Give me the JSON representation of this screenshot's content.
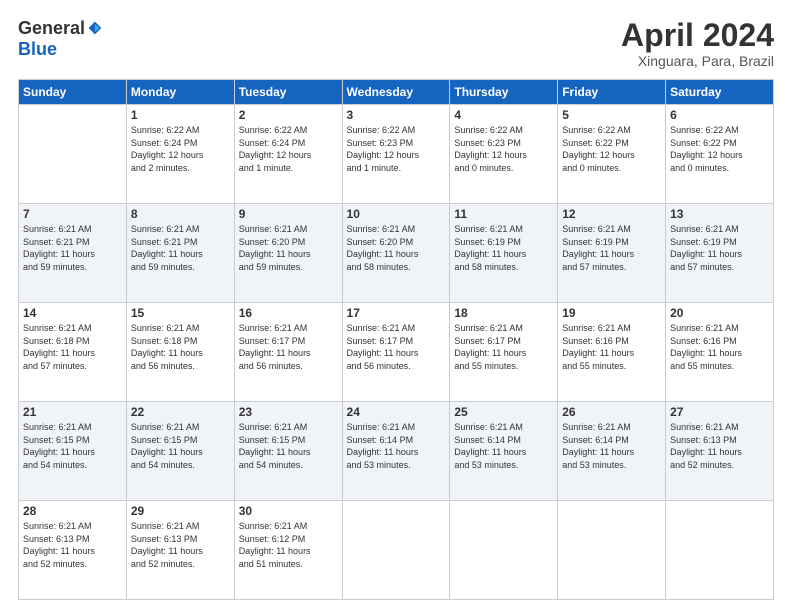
{
  "header": {
    "logo_general": "General",
    "logo_blue": "Blue",
    "title": "April 2024",
    "location": "Xinguara, Para, Brazil"
  },
  "weekdays": [
    "Sunday",
    "Monday",
    "Tuesday",
    "Wednesday",
    "Thursday",
    "Friday",
    "Saturday"
  ],
  "weeks": [
    [
      {
        "day": "",
        "info": ""
      },
      {
        "day": "1",
        "info": "Sunrise: 6:22 AM\nSunset: 6:24 PM\nDaylight: 12 hours\nand 2 minutes."
      },
      {
        "day": "2",
        "info": "Sunrise: 6:22 AM\nSunset: 6:24 PM\nDaylight: 12 hours\nand 1 minute."
      },
      {
        "day": "3",
        "info": "Sunrise: 6:22 AM\nSunset: 6:23 PM\nDaylight: 12 hours\nand 1 minute."
      },
      {
        "day": "4",
        "info": "Sunrise: 6:22 AM\nSunset: 6:23 PM\nDaylight: 12 hours\nand 0 minutes."
      },
      {
        "day": "5",
        "info": "Sunrise: 6:22 AM\nSunset: 6:22 PM\nDaylight: 12 hours\nand 0 minutes."
      },
      {
        "day": "6",
        "info": "Sunrise: 6:22 AM\nSunset: 6:22 PM\nDaylight: 12 hours\nand 0 minutes."
      }
    ],
    [
      {
        "day": "7",
        "info": "Sunrise: 6:21 AM\nSunset: 6:21 PM\nDaylight: 11 hours\nand 59 minutes."
      },
      {
        "day": "8",
        "info": "Sunrise: 6:21 AM\nSunset: 6:21 PM\nDaylight: 11 hours\nand 59 minutes."
      },
      {
        "day": "9",
        "info": "Sunrise: 6:21 AM\nSunset: 6:20 PM\nDaylight: 11 hours\nand 59 minutes."
      },
      {
        "day": "10",
        "info": "Sunrise: 6:21 AM\nSunset: 6:20 PM\nDaylight: 11 hours\nand 58 minutes."
      },
      {
        "day": "11",
        "info": "Sunrise: 6:21 AM\nSunset: 6:19 PM\nDaylight: 11 hours\nand 58 minutes."
      },
      {
        "day": "12",
        "info": "Sunrise: 6:21 AM\nSunset: 6:19 PM\nDaylight: 11 hours\nand 57 minutes."
      },
      {
        "day": "13",
        "info": "Sunrise: 6:21 AM\nSunset: 6:19 PM\nDaylight: 11 hours\nand 57 minutes."
      }
    ],
    [
      {
        "day": "14",
        "info": "Sunrise: 6:21 AM\nSunset: 6:18 PM\nDaylight: 11 hours\nand 57 minutes."
      },
      {
        "day": "15",
        "info": "Sunrise: 6:21 AM\nSunset: 6:18 PM\nDaylight: 11 hours\nand 56 minutes."
      },
      {
        "day": "16",
        "info": "Sunrise: 6:21 AM\nSunset: 6:17 PM\nDaylight: 11 hours\nand 56 minutes."
      },
      {
        "day": "17",
        "info": "Sunrise: 6:21 AM\nSunset: 6:17 PM\nDaylight: 11 hours\nand 56 minutes."
      },
      {
        "day": "18",
        "info": "Sunrise: 6:21 AM\nSunset: 6:17 PM\nDaylight: 11 hours\nand 55 minutes."
      },
      {
        "day": "19",
        "info": "Sunrise: 6:21 AM\nSunset: 6:16 PM\nDaylight: 11 hours\nand 55 minutes."
      },
      {
        "day": "20",
        "info": "Sunrise: 6:21 AM\nSunset: 6:16 PM\nDaylight: 11 hours\nand 55 minutes."
      }
    ],
    [
      {
        "day": "21",
        "info": "Sunrise: 6:21 AM\nSunset: 6:15 PM\nDaylight: 11 hours\nand 54 minutes."
      },
      {
        "day": "22",
        "info": "Sunrise: 6:21 AM\nSunset: 6:15 PM\nDaylight: 11 hours\nand 54 minutes."
      },
      {
        "day": "23",
        "info": "Sunrise: 6:21 AM\nSunset: 6:15 PM\nDaylight: 11 hours\nand 54 minutes."
      },
      {
        "day": "24",
        "info": "Sunrise: 6:21 AM\nSunset: 6:14 PM\nDaylight: 11 hours\nand 53 minutes."
      },
      {
        "day": "25",
        "info": "Sunrise: 6:21 AM\nSunset: 6:14 PM\nDaylight: 11 hours\nand 53 minutes."
      },
      {
        "day": "26",
        "info": "Sunrise: 6:21 AM\nSunset: 6:14 PM\nDaylight: 11 hours\nand 53 minutes."
      },
      {
        "day": "27",
        "info": "Sunrise: 6:21 AM\nSunset: 6:13 PM\nDaylight: 11 hours\nand 52 minutes."
      }
    ],
    [
      {
        "day": "28",
        "info": "Sunrise: 6:21 AM\nSunset: 6:13 PM\nDaylight: 11 hours\nand 52 minutes."
      },
      {
        "day": "29",
        "info": "Sunrise: 6:21 AM\nSunset: 6:13 PM\nDaylight: 11 hours\nand 52 minutes."
      },
      {
        "day": "30",
        "info": "Sunrise: 6:21 AM\nSunset: 6:12 PM\nDaylight: 11 hours\nand 51 minutes."
      },
      {
        "day": "",
        "info": ""
      },
      {
        "day": "",
        "info": ""
      },
      {
        "day": "",
        "info": ""
      },
      {
        "day": "",
        "info": ""
      }
    ]
  ],
  "row_classes": [
    "row-white",
    "row-shaded",
    "row-white",
    "row-shaded",
    "row-white"
  ]
}
